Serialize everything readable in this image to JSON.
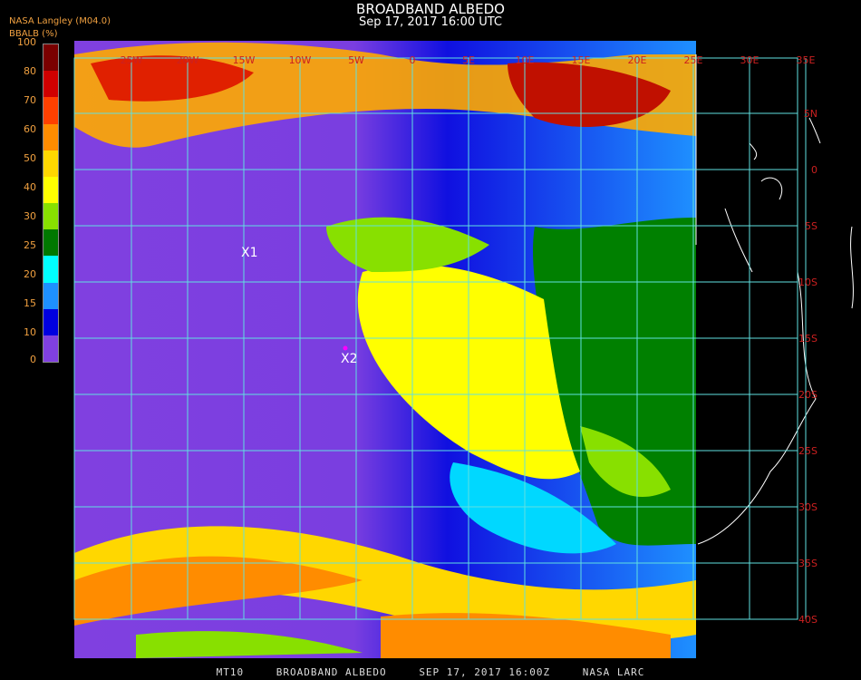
{
  "header": {
    "title": "BROADBAND ALBEDO",
    "subtitle": "Sep 17, 2017 16:00 UTC",
    "org": "NASA Langley (M04.0)",
    "unit": "BBALB (%)"
  },
  "legend": {
    "ticks": [
      "100",
      "80",
      "70",
      "60",
      "50",
      "40",
      "30",
      "25",
      "20",
      "15",
      "10",
      "0"
    ],
    "colors": [
      "#7a0000",
      "#d00000",
      "#ff4000",
      "#ff8c00",
      "#ffd700",
      "#ffff00",
      "#88e000",
      "#007800",
      "#00ffff",
      "#1e90ff",
      "#0000e0",
      "#8040e0"
    ]
  },
  "map": {
    "lat_labels": [
      "5N",
      "0",
      "5S",
      "10S",
      "15S",
      "20S",
      "25S",
      "30S",
      "35S",
      "40S"
    ],
    "lon_labels": [
      "25W",
      "20W",
      "15W",
      "10W",
      "5W",
      "0",
      "5E",
      "10E",
      "15E",
      "20E",
      "25E",
      "30E",
      "35E"
    ],
    "markers": [
      {
        "label": "X1"
      },
      {
        "label": "X2"
      }
    ],
    "grid_color": "#60e0e0",
    "label_color": "#cc2020"
  },
  "footer": {
    "product": "MT10",
    "name": "BROADBAND ALBEDO",
    "datetime": "SEP 17, 2017 16:00Z",
    "source": "NASA LARC"
  }
}
